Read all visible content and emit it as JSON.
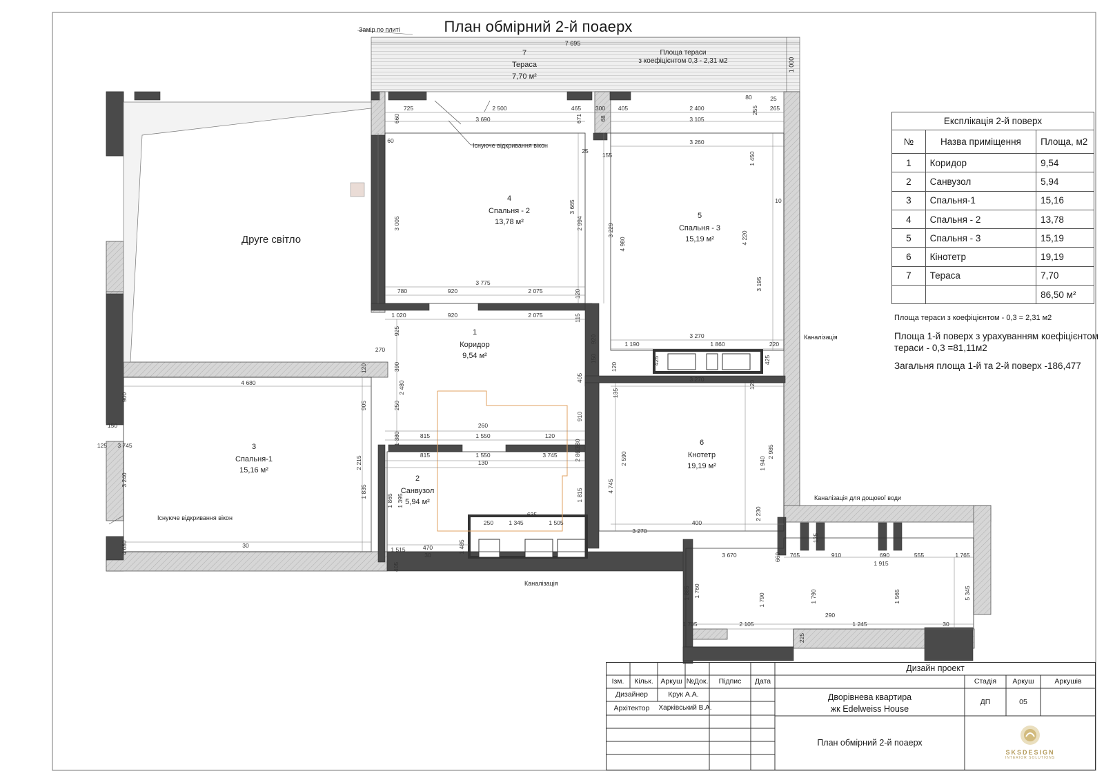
{
  "title": "План обмірний 2-й поаерх",
  "measure_note": "Замір по плиті",
  "terrace": {
    "number": "7",
    "name": "Тераса",
    "area": "7,70 м²",
    "coef_note_line1": "Площа тераси",
    "coef_note_line2": "з коефіцієнтом 0,3 - 2,31 м2",
    "width": "7 695",
    "depth": "1 000"
  },
  "labels": {
    "second_light": "Друге світло",
    "window_opening_1": "Існуюче відкривання вікон",
    "window_opening_2": "Існуюче відкривання вікон",
    "sewer_1": "Каналізація",
    "sewer_2": "Каналізація",
    "rain_sewer": "Каналізація для дощової води"
  },
  "rooms": [
    {
      "number": "4",
      "name": "Спальня - 2",
      "area": "13,78 м²"
    },
    {
      "number": "5",
      "name": "Спальня - 3",
      "area": "15,19 м²"
    },
    {
      "number": "1",
      "name": "Коридор",
      "area": "9,54 м²"
    },
    {
      "number": "3",
      "name": "Спальня-1",
      "area": "15,16 м²"
    },
    {
      "number": "2",
      "name": "Санвузол",
      "area": "5,94 м²"
    },
    {
      "number": "6",
      "name": "Кнотетр",
      "area": "19,19 м²"
    }
  ],
  "dimensions": [
    "725",
    "2 500",
    "465",
    "300",
    "405",
    "2 400",
    "80",
    "255",
    "265",
    "25",
    "3 690",
    "3 105",
    "660",
    "671",
    "60",
    "68",
    "25",
    "155",
    "3 260",
    "3 005",
    "3 665",
    "2 994",
    "3 229",
    "4 980",
    "1 450",
    "4 220",
    "10",
    "3 195",
    "3 775",
    "780",
    "920",
    "2 075",
    "120",
    "1 020",
    "920",
    "2 075",
    "115",
    "925",
    "920",
    "3 270",
    "1 190",
    "1 860",
    "220",
    "150",
    "120",
    "425",
    "425",
    "270",
    "4 680",
    "120",
    "390",
    "2 480",
    "405",
    "3 270",
    "120",
    "135",
    "900",
    "905",
    "910",
    "250",
    "150",
    "125",
    "3 745",
    "260",
    "1 380",
    "815",
    "1 550",
    "120",
    "1 380",
    "815",
    "1 550",
    "3 745",
    "130",
    "2 860",
    "2 590",
    "2 985",
    "1 940",
    "3 240",
    "2 215",
    "1 835",
    "1 865",
    "1 395",
    "1 815",
    "4 745",
    "2 230",
    "635",
    "250",
    "1 345",
    "1 505",
    "3 270",
    "400",
    "4 680",
    "30",
    "1 515",
    "470",
    "1 485",
    "30",
    "405",
    "125",
    "660",
    "765",
    "910",
    "690",
    "555",
    "1 765",
    "3 670",
    "1 915",
    "1 885",
    "1 760",
    "1 790",
    "1 790",
    "1 565",
    "5 345",
    "290",
    "1 705",
    "2 105",
    "1 245",
    "30",
    "225"
  ],
  "explication": {
    "caption": "Експлікація 2-й поверх",
    "headers": [
      "№",
      "Назва приміщення",
      "Площа, м2"
    ],
    "rows": [
      [
        "1",
        "Коридор",
        "9,54"
      ],
      [
        "2",
        "Санвузол",
        "5,94"
      ],
      [
        "3",
        "Спальня-1",
        "15,16"
      ],
      [
        "4",
        "Спальня - 2",
        "13,78"
      ],
      [
        "5",
        "Спальня - 3",
        "15,19"
      ],
      [
        "6",
        "Кінотетр",
        "19,19"
      ],
      [
        "7",
        "Тераса",
        "7,70"
      ]
    ],
    "total": "86,50 м²",
    "note_terrace": "Площа тераси з коефіцієнтом - 0,3 = 2,31 м2",
    "note_floor1": "Площа  1-й поверх з урахуванням коефіцієнтом тераси - 0,3 =81,11м2",
    "note_total": "Загальня площа 1-й та 2-й поверх -186,477"
  },
  "stamp": {
    "project_title": "Дизайн проект",
    "cols": [
      "Ізм.",
      "Кільк.",
      "Аркуш",
      "№Док.",
      "Підпис",
      "Дата"
    ],
    "designer_role": "Дизайнер",
    "designer_name": "Крук А.А.",
    "architect_role": "Архітектор",
    "architect_name": "Харківський В.А.",
    "object_line1": "Дворівнева квартира",
    "object_line2": "жк Edelweiss House",
    "stage_label": "Стадія",
    "sheet_label": "Аркуш",
    "sheets_label": "Аркушів",
    "stage_value": "ДП",
    "sheet_value": "05",
    "sheets_value": "",
    "drawing_name": "План обмірний 2-й поаерх",
    "logo": "SKSDESIGN",
    "logo_sub": "INTERIOR SOLUTIONS"
  },
  "colors": {
    "wall_fill": "#cfcfcf",
    "wall_dark": "#4a4a4a",
    "line": "#333333",
    "orange_outline": "#e0a060",
    "accent_gold": "#b39a5a"
  }
}
